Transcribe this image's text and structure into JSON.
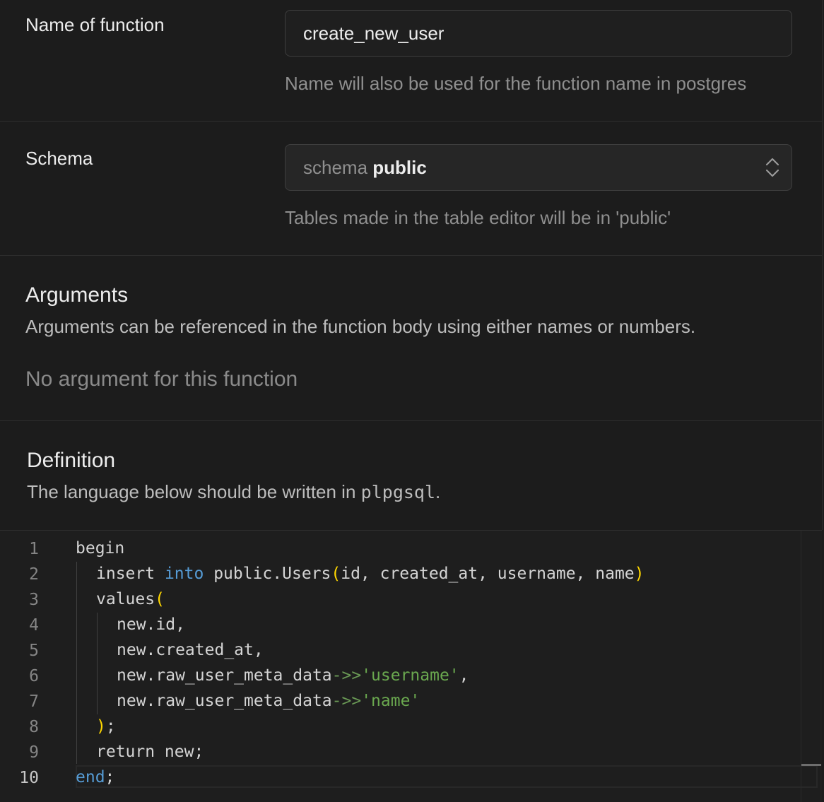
{
  "name_field": {
    "label": "Name of function",
    "value": "create_new_user",
    "help": "Name will also be used for the function name in postgres"
  },
  "schema_field": {
    "label": "Schema",
    "prefix": "schema",
    "value": "public",
    "help": "Tables made in the table editor will be in 'public'"
  },
  "arguments": {
    "title": "Arguments",
    "description": "Arguments can be referenced in the function body using either names or numbers.",
    "empty": "No argument for this function"
  },
  "definition": {
    "title": "Definition",
    "description_prefix": "The language below should be written in",
    "language": "plpgsql",
    "description_suffix": "."
  },
  "editor": {
    "line_numbers": [
      "1",
      "2",
      "3",
      "4",
      "5",
      "6",
      "7",
      "8",
      "9",
      "10"
    ],
    "active_line": 10,
    "code": {
      "l1": "begin",
      "l2_kw1": "insert",
      "l2_kw2": "into",
      "l2_text": " public.Users",
      "l2_open": "(",
      "l2_args": "id, created_at, username, name",
      "l2_close": ")",
      "l3_text": "values",
      "l3_open": "(",
      "l4": "new.id,",
      "l5": "new.created_at,",
      "l6_text": "new.raw_user_meta_data",
      "l6_op": "->>",
      "l6_str": "'username'",
      "l6_end": ",",
      "l7_text": "new.raw_user_meta_data",
      "l7_op": "->>",
      "l7_str": "'name'",
      "l8_close": ")",
      "l8_end": ";",
      "l9": "return new;",
      "l10_kw": "end",
      "l10_end": ";"
    }
  }
}
